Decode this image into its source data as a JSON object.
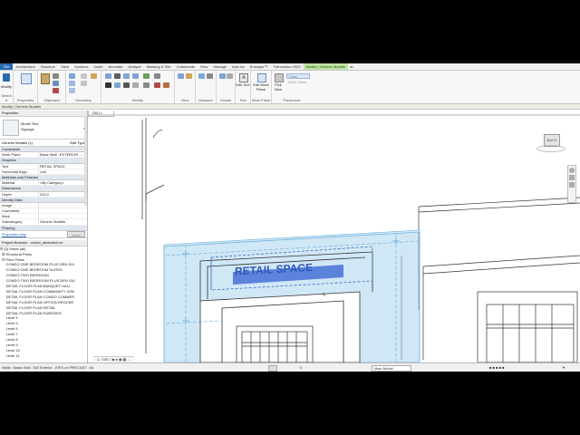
{
  "ribbon": {
    "tabs": [
      "File",
      "Architecture",
      "Structure",
      "Steel",
      "Systems",
      "Insert",
      "Annotate",
      "Analyze",
      "Massing & Site",
      "Collaborate",
      "View",
      "Manage",
      "Add-Ins",
      "Enscape™",
      "Twinmotion 2020",
      "Modify | Generic Models"
    ],
    "active_tab": "Modify | Generic Models",
    "groups": [
      "Select",
      "Properties",
      "Clipboard",
      "Geometry",
      "Modify",
      "View",
      "Measure",
      "Create",
      "Text",
      "Work Plane",
      "Placement"
    ],
    "buttons": {
      "modify": "Modify",
      "properties": "Properties",
      "paste": "Paste",
      "cut": "Cut",
      "join": "Join",
      "edit_text": "Edit Text",
      "edit_work_plane": "Edit Work Plane",
      "pick_new": "Pick New",
      "face": "Face",
      "work_plane": "Work Plane"
    },
    "select_label": "Select ▾"
  },
  "context_bar": "Modify | Generic Models",
  "properties": {
    "header": "Properties",
    "type_name": "Model Text",
    "type_sub": "Signage",
    "instance_selector": "Generic Models (1)",
    "edit_type": "Edit Type",
    "rows": [
      {
        "cat": "Constraints"
      },
      {
        "k": "Work Plane",
        "v": "Basic Wall : EXTERIOR -..."
      },
      {
        "cat": "Graphics"
      },
      {
        "k": "Text",
        "v": "RETAIL SPACE"
      },
      {
        "k": "Horizontal Align",
        "v": "Left"
      },
      {
        "cat": "Materials and Finishes"
      },
      {
        "k": "Material",
        "v": "<By Category>"
      },
      {
        "cat": "Dimensions"
      },
      {
        "k": "Depth",
        "v": "200.0"
      },
      {
        "cat": "Identity Data"
      },
      {
        "k": "Image",
        "v": ""
      },
      {
        "k": "Comments",
        "v": ""
      },
      {
        "k": "Mark",
        "v": ""
      },
      {
        "k": "Subcategory",
        "v": "Generic Models"
      },
      {
        "cat": "Phasing"
      }
    ],
    "help_link": "Properties help",
    "apply": "Apply"
  },
  "browser": {
    "header": "Project Browser - condo_detached.rvt",
    "items": [
      "⊟ [0] Views (all)",
      "  ⊞ Structural Plans",
      "  ⊟ Floor Plans",
      "      CONDO ONE BEDROOM PLUS DEN SUI",
      "      CONDO ONE BEDROOM SUITES",
      "      CONDO TWO BEDROOM",
      "      CONDO TWO BEDROOM PLUS DEN SUI",
      "      DETAIL FLOOR PLAN BANQUET HALL",
      "      DETAIL FLOOR PLAN COMMUNITY CEN",
      "      DETAIL FLOOR PLAN CONDO COMMER",
      "      DETAIL FLOOR PLAN OFFICE/GROCER",
      "      DETAIL FLOOR PLAN RETAIL",
      "      DETAIL FLOOR PLAN SUBSIZED",
      "      Level 4",
      "      Level 5",
      "      Level 6",
      "      Level 7",
      "      Level 8",
      "      Level 9",
      "      Level 10",
      "      Level 11"
    ]
  },
  "view": {
    "tab_label": "{3D}",
    "sign_text": "RETAIL SPACE",
    "scale": "1 : 100",
    "viewcube": "BACK"
  },
  "status": {
    "left": "Walls : Basic Wall : W2 Exterior - EIFS on PRECAST : 84",
    "filter_count": ":0",
    "main_model": "Main Model"
  },
  "colors": {
    "accent": "#2a6ab3",
    "contextual_tab": "#bfe3a4",
    "highlight_blue": "#a9d3ee",
    "sign_text": "#4f78d8"
  }
}
